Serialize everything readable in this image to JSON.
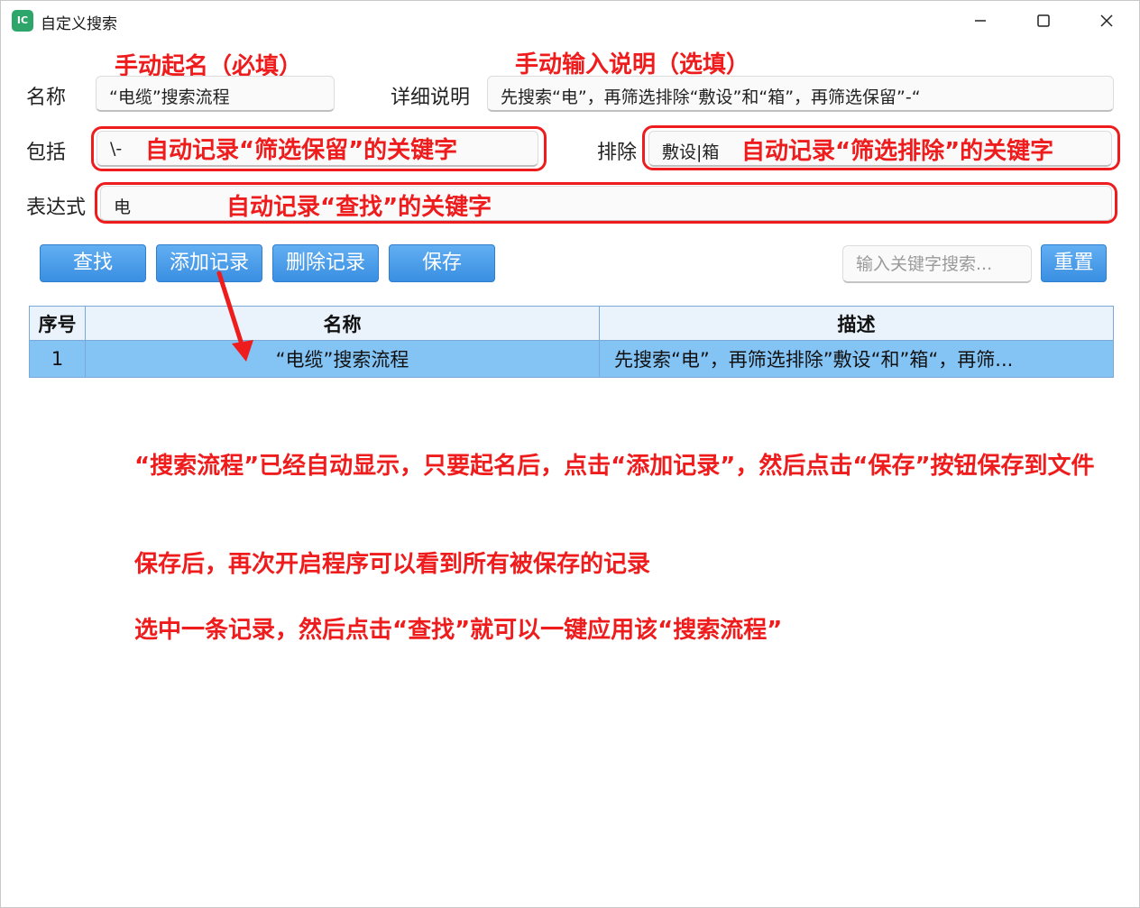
{
  "window": {
    "title": "自定义搜索",
    "icon_label": "IC",
    "controls": [
      "minimize-icon",
      "maximize-icon",
      "close-icon"
    ]
  },
  "form": {
    "name_label": "名称",
    "name_value": "“电缆”搜索流程",
    "detail_label": "详细说明",
    "detail_value": "先搜索“电”，再筛选排除“敷设”和“箱”，再筛选保留”-“",
    "include_label": "包括",
    "include_value": "\\-",
    "exclude_label": "排除",
    "exclude_value": "敷设|箱",
    "expr_label": "表达式",
    "expr_value": "电"
  },
  "annotations": {
    "name_hint": "手动起名（必填）",
    "detail_hint": "手动输入说明（选填）",
    "include_hint": "自动记录“筛选保留”的关键字",
    "exclude_hint": "自动记录“筛选排除”的关键字",
    "expr_hint": "自动记录“查找”的关键字"
  },
  "toolbar": {
    "find": "查找",
    "add": "添加记录",
    "delete": "删除记录",
    "save": "保存",
    "search_placeholder": "输入关键字搜索...",
    "reset": "重置"
  },
  "table": {
    "headers": [
      "序号",
      "名称",
      "描述"
    ],
    "rows": [
      [
        "1",
        "“电缆”搜索流程",
        "先搜索“电”，再筛选排除”敷设“和”箱“，再筛..."
      ]
    ]
  },
  "notes": [
    "“搜索流程”已经自动显示，只要起名后，点击“添加记录”，然后点击“保存”按钮保存到文件",
    "保存后，再次开启程序可以看到所有被保存的记录",
    "选中一条记录，然后点击“查找”就可以一键应用该“搜索流程”"
  ],
  "colors": {
    "annotation": "#ee1c1c",
    "button": "#3a8fe2",
    "row_selected": "#84c4f5"
  }
}
